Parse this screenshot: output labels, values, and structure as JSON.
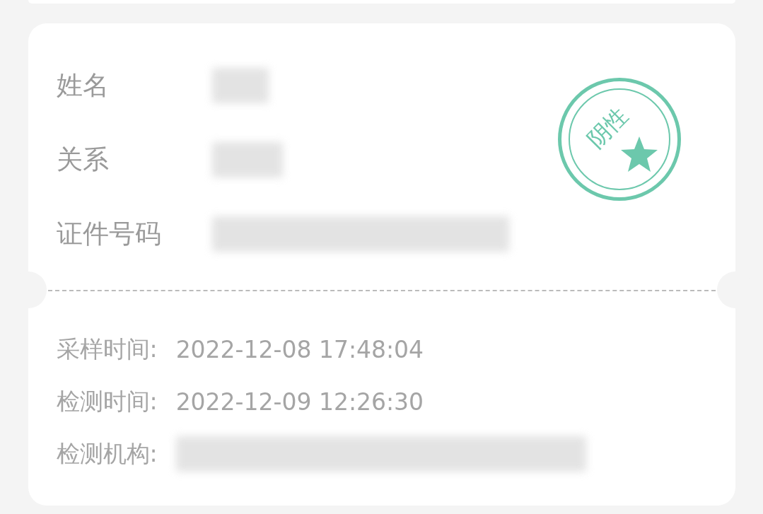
{
  "identity": {
    "fields": [
      {
        "label": "姓名",
        "kind": "redacted"
      },
      {
        "label": "关系",
        "kind": "redacted"
      },
      {
        "label": "证件号码",
        "kind": "redacted"
      }
    ]
  },
  "stamp": {
    "text": "阴性",
    "color": "#6cc8ac"
  },
  "details": [
    {
      "label": "采样时间:",
      "value": "2022-12-08 17:48:04",
      "kind": "text"
    },
    {
      "label": "检测时间:",
      "value": "2022-12-09 12:26:30",
      "kind": "text"
    },
    {
      "label": "检测机构:",
      "kind": "redacted"
    }
  ]
}
